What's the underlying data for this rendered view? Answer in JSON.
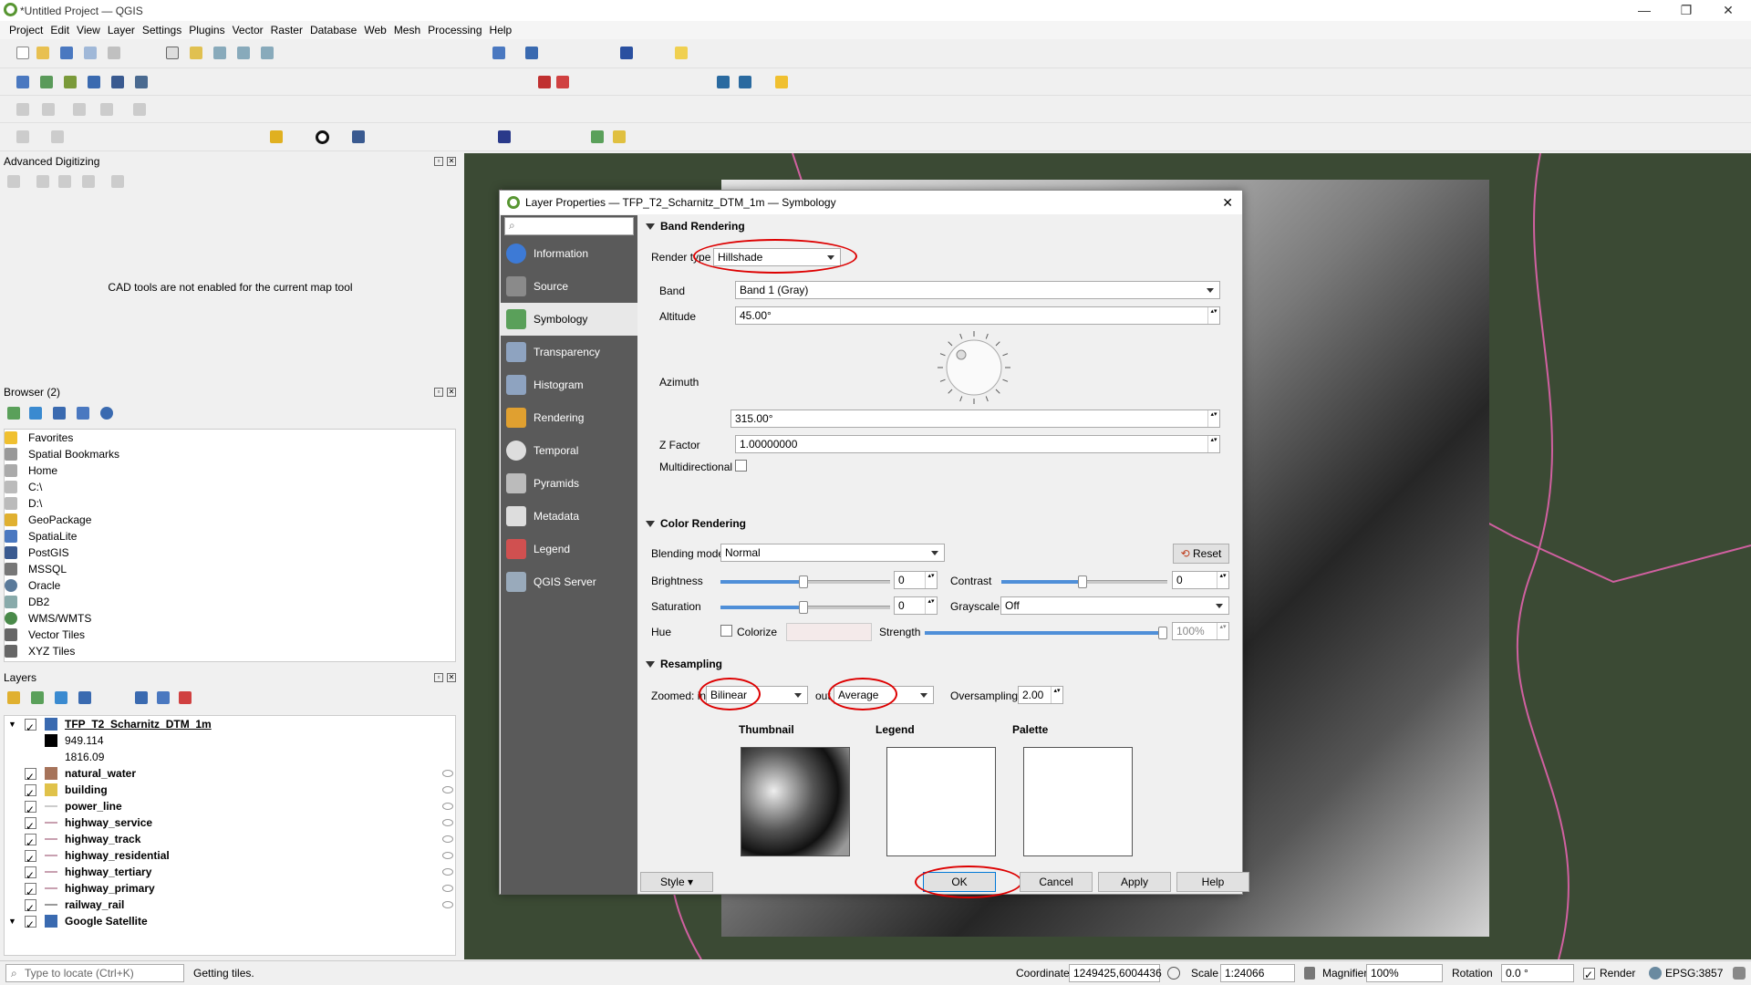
{
  "window": {
    "title": "*Untitled Project — QGIS",
    "min": "—",
    "max": "❐",
    "close": "✕"
  },
  "menu": [
    "Project",
    "Edit",
    "View",
    "Layer",
    "Settings",
    "Plugins",
    "Vector",
    "Raster",
    "Database",
    "Web",
    "Mesh",
    "Processing",
    "Help"
  ],
  "advanced_digitizing": {
    "title": "Advanced Digitizing",
    "message": "CAD tools are not enabled for the current map tool"
  },
  "browser": {
    "title": "Browser (2)",
    "items": [
      "Favorites",
      "Spatial Bookmarks",
      "Home",
      "C:\\",
      "D:\\",
      "GeoPackage",
      "SpatiaLite",
      "PostGIS",
      "MSSQL",
      "Oracle",
      "DB2",
      "WMS/WMTS",
      "Vector Tiles",
      "XYZ Tiles"
    ]
  },
  "layers": {
    "title": "Layers",
    "root": "TFP_T2_Scharnitz_DTM_1m",
    "legend_min": "949.114",
    "legend_max": "1816.09",
    "items": [
      {
        "name": "natural_water",
        "color": "#a6735a"
      },
      {
        "name": "building",
        "color": "#e0c24a"
      },
      {
        "name": "power_line",
        "color": "#cccccc"
      },
      {
        "name": "highway_service",
        "color": "#c8a0b0"
      },
      {
        "name": "highway_track",
        "color": "#c8a0b0"
      },
      {
        "name": "highway_residential",
        "color": "#c8a0b0"
      },
      {
        "name": "highway_tertiary",
        "color": "#c8a0b0"
      },
      {
        "name": "highway_primary",
        "color": "#c8a0b0"
      },
      {
        "name": "railway_rail",
        "color": "#999999"
      }
    ],
    "last": "Google Satellite"
  },
  "dialog": {
    "title": "Layer Properties — TFP_T2_Scharnitz_DTM_1m — Symbology",
    "close": "✕",
    "sidebar": [
      {
        "label": "Information",
        "icon": "info-icon",
        "color": "#3d7ad6"
      },
      {
        "label": "Source",
        "icon": "source-icon",
        "color": "#8a8a8a"
      },
      {
        "label": "Symbology",
        "icon": "symbology-icon",
        "color": "#5aa05a"
      },
      {
        "label": "Transparency",
        "icon": "transparency-icon",
        "color": "#8ea3c0"
      },
      {
        "label": "Histogram",
        "icon": "histogram-icon",
        "color": "#8ea3c0"
      },
      {
        "label": "Rendering",
        "icon": "rendering-icon",
        "color": "#e0a030"
      },
      {
        "label": "Temporal",
        "icon": "clock-icon",
        "color": "#dddddd"
      },
      {
        "label": "Pyramids",
        "icon": "pyramids-icon",
        "color": "#bbbbbb"
      },
      {
        "label": "Metadata",
        "icon": "metadata-icon",
        "color": "#dddddd"
      },
      {
        "label": "Legend",
        "icon": "legend-icon",
        "color": "#d05050"
      },
      {
        "label": "QGIS Server",
        "icon": "server-icon",
        "color": "#9ab"
      }
    ],
    "band_rendering": {
      "header": "Band Rendering",
      "render_type_label": "Render type",
      "render_type": "Hillshade",
      "band_label": "Band",
      "band": "Band 1 (Gray)",
      "altitude_label": "Altitude",
      "altitude": "45.00°",
      "azimuth_label": "Azimuth",
      "azimuth": "315.00°",
      "zfactor_label": "Z Factor",
      "zfactor": "1.00000000",
      "multidirectional_label": "Multidirectional"
    },
    "color_rendering": {
      "header": "Color Rendering",
      "blending_label": "Blending mode",
      "blending": "Normal",
      "reset": "Reset",
      "brightness_label": "Brightness",
      "brightness": "0",
      "contrast_label": "Contrast",
      "contrast": "0",
      "saturation_label": "Saturation",
      "saturation": "0",
      "grayscale_label": "Grayscale",
      "grayscale": "Off",
      "hue_label": "Hue",
      "colorize_label": "Colorize",
      "strength_label": "Strength",
      "strength": "100%"
    },
    "resampling": {
      "header": "Resampling",
      "zoomed_in_label": "Zoomed: in",
      "zoomed_in": "Bilinear",
      "out_label": "out",
      "out": "Average",
      "oversampling_label": "Oversampling",
      "oversampling": "2.00"
    },
    "previews": {
      "thumbnail": "Thumbnail",
      "legend": "Legend",
      "palette": "Palette"
    },
    "buttons": {
      "style": "Style",
      "ok": "OK",
      "cancel": "Cancel",
      "apply": "Apply",
      "help": "Help"
    }
  },
  "status": {
    "locate_placeholder": "Type to locate (Ctrl+K)",
    "message": "Getting tiles.",
    "coordinate_label": "Coordinate",
    "coordinate": "1249425,6004436",
    "scale_label": "Scale",
    "scale": "1:24066",
    "magnifier_label": "Magnifier",
    "magnifier": "100%",
    "rotation_label": "Rotation",
    "rotation": "0.0 °",
    "render_label": "Render",
    "crs": "EPSG:3857"
  }
}
